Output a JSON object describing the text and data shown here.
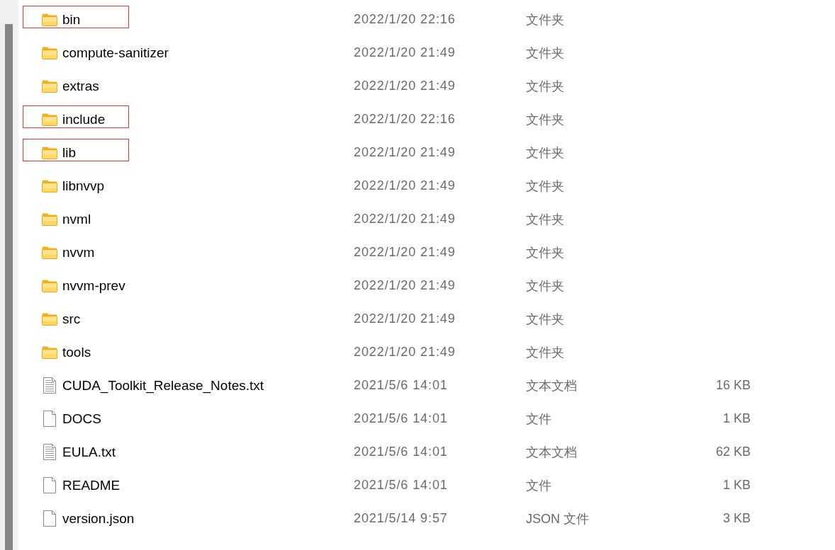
{
  "file_list": {
    "rows": [
      {
        "kind": "folder",
        "name": "bin",
        "modified": "2022/1/20 22:16",
        "type": "文件夹",
        "highlighted": true
      },
      {
        "kind": "folder",
        "name": "compute-sanitizer",
        "modified": "2022/1/20 21:49",
        "type": "文件夹",
        "highlighted": false
      },
      {
        "kind": "folder",
        "name": "extras",
        "modified": "2022/1/20 21:49",
        "type": "文件夹",
        "highlighted": false
      },
      {
        "kind": "folder",
        "name": "include",
        "modified": "2022/1/20 22:16",
        "type": "文件夹",
        "highlighted": true
      },
      {
        "kind": "folder",
        "name": "lib",
        "modified": "2022/1/20 21:49",
        "type": "文件夹",
        "highlighted": true
      },
      {
        "kind": "folder",
        "name": "libnvvp",
        "modified": "2022/1/20 21:49",
        "type": "文件夹",
        "highlighted": false
      },
      {
        "kind": "folder",
        "name": "nvml",
        "modified": "2022/1/20 21:49",
        "type": "文件夹",
        "highlighted": false
      },
      {
        "kind": "folder",
        "name": "nvvm",
        "modified": "2022/1/20 21:49",
        "type": "文件夹",
        "highlighted": false
      },
      {
        "kind": "folder",
        "name": "nvvm-prev",
        "modified": "2022/1/20 21:49",
        "type": "文件夹",
        "highlighted": false
      },
      {
        "kind": "folder",
        "name": "src",
        "modified": "2022/1/20 21:49",
        "type": "文件夹",
        "highlighted": false
      },
      {
        "kind": "folder",
        "name": "tools",
        "modified": "2022/1/20 21:49",
        "type": "文件夹",
        "highlighted": false
      },
      {
        "kind": "text",
        "name": "CUDA_Toolkit_Release_Notes.txt",
        "modified": "2021/5/6 14:01",
        "type": "文本文档",
        "size": "16 KB",
        "highlighted": false
      },
      {
        "kind": "file",
        "name": "DOCS",
        "modified": "2021/5/6 14:01",
        "type": "文件",
        "size": "1 KB",
        "highlighted": false
      },
      {
        "kind": "text",
        "name": "EULA.txt",
        "modified": "2021/5/6 14:01",
        "type": "文本文档",
        "size": "62 KB",
        "highlighted": false
      },
      {
        "kind": "file",
        "name": "README",
        "modified": "2021/5/6 14:01",
        "type": "文件",
        "size": "1 KB",
        "highlighted": false
      },
      {
        "kind": "file",
        "name": "version.json",
        "modified": "2021/5/14 9:57",
        "type": "JSON 文件",
        "size": "3 KB",
        "highlighted": false
      }
    ]
  }
}
